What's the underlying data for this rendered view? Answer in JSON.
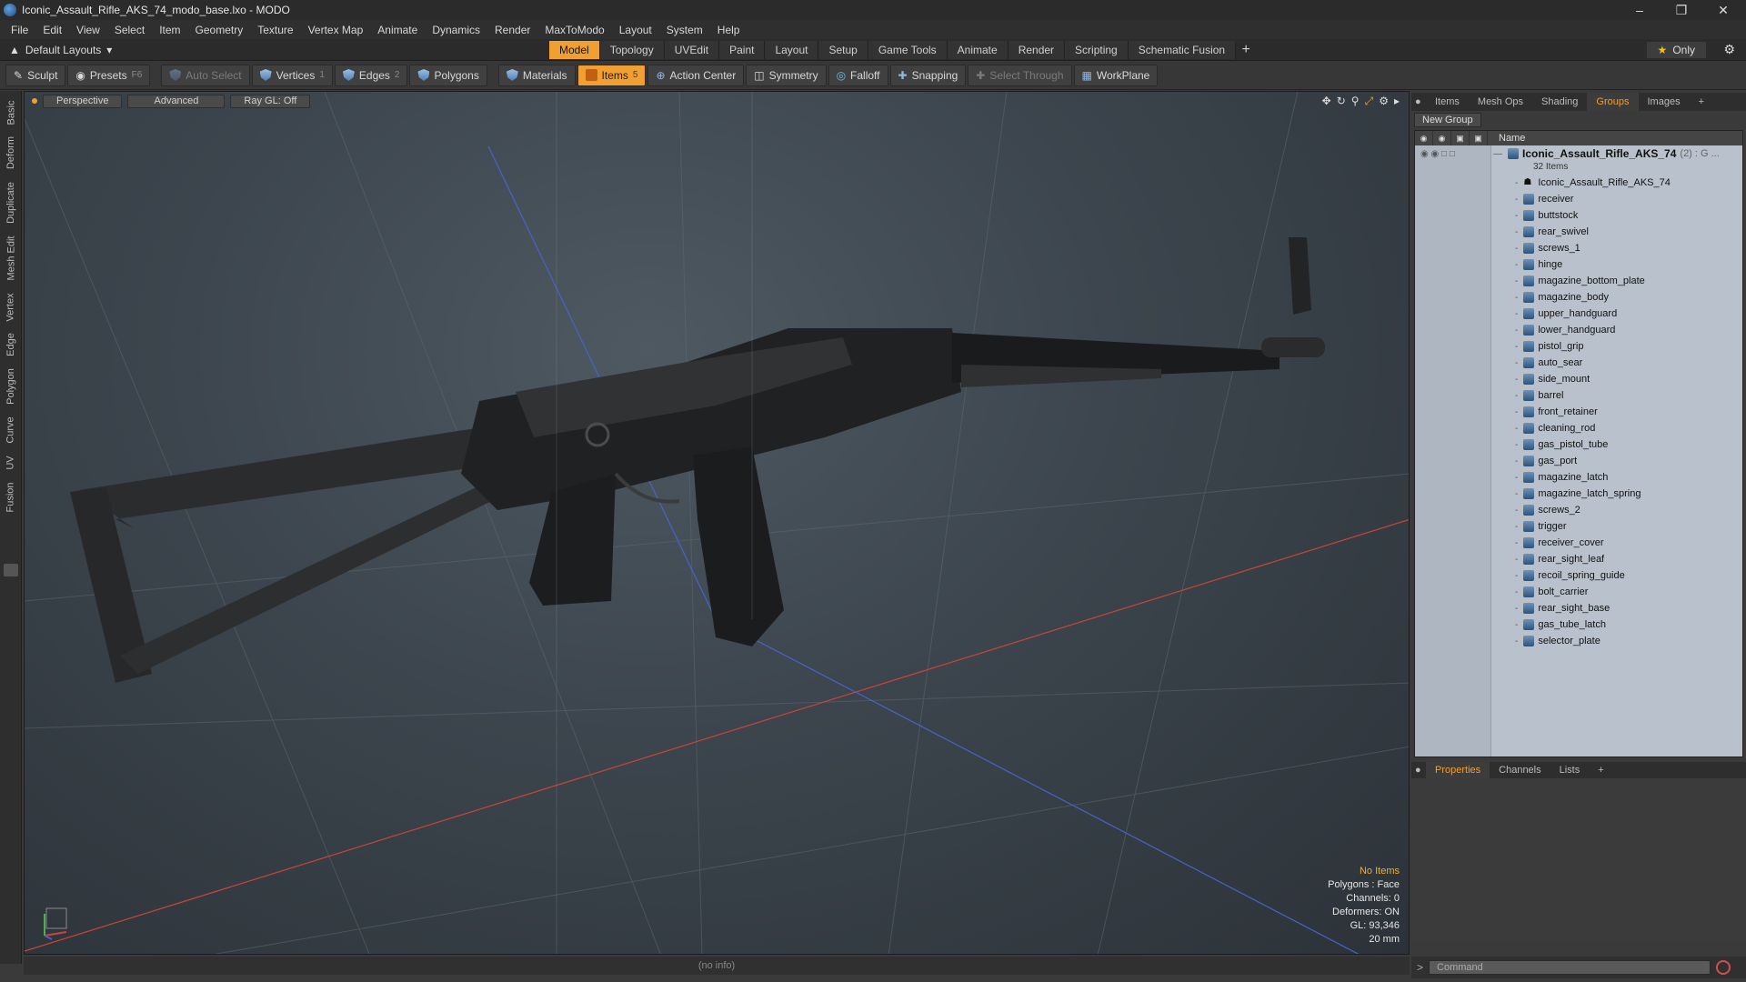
{
  "window": {
    "title": "Iconic_Assault_Rifle_AKS_74_modo_base.lxo - MODO"
  },
  "menu": [
    "File",
    "Edit",
    "View",
    "Select",
    "Item",
    "Geometry",
    "Texture",
    "Vertex Map",
    "Animate",
    "Dynamics",
    "Render",
    "MaxToModo",
    "Layout",
    "System",
    "Help"
  ],
  "layoutbar": {
    "layout_select": "Default Layouts",
    "tabs": [
      "Model",
      "Topology",
      "UVEdit",
      "Paint",
      "Layout",
      "Setup",
      "Game Tools",
      "Animate",
      "Render",
      "Scripting",
      "Schematic Fusion"
    ],
    "active_tab": "Model",
    "only_label": "Only"
  },
  "toolbar": {
    "sculpt": "Sculpt",
    "presets": "Presets",
    "presets_key": "F6",
    "auto_select": "Auto Select",
    "vertices": "Vertices",
    "vertices_key": "1",
    "edges": "Edges",
    "edges_key": "2",
    "polygons": "Polygons",
    "materials": "Materials",
    "items": "Items",
    "items_key": "5",
    "action_center": "Action Center",
    "symmetry": "Symmetry",
    "falloff": "Falloff",
    "snapping": "Snapping",
    "select_through": "Select Through",
    "workplane": "WorkPlane"
  },
  "left_tabs": [
    "Basic",
    "Deform",
    "Duplicate",
    "Mesh Edit",
    "Vertex",
    "Edge",
    "Polygon",
    "Curve",
    "UV",
    "Fusion"
  ],
  "viewport": {
    "view_mode": "Perspective",
    "shading": "Advanced",
    "raygl": "Ray GL: Off",
    "info": {
      "selection": "No Items",
      "polygons": "Polygons : Face",
      "channels": "Channels: 0",
      "deformers": "Deformers: ON",
      "gl": "GL: 93,346",
      "scale": "20 mm"
    },
    "colors": {
      "x_axis": "#c8453a",
      "z_axis": "#4a62c8",
      "accent": "#f0a030"
    }
  },
  "right_panel": {
    "tabs": [
      "Items",
      "Mesh Ops",
      "Shading",
      "Groups",
      "Images"
    ],
    "active_tab": "Groups",
    "new_group": "New Group",
    "tree_header": "Name",
    "root": {
      "name": "Iconic_Assault_Rifle_AKS_74",
      "count": "(2) : G ...",
      "items_count": "32 Items"
    },
    "items": [
      "Iconic_Assault_Rifle_AKS_74",
      "receiver",
      "buttstock",
      "rear_swivel",
      "screws_1",
      "hinge",
      "magazine_bottom_plate",
      "magazine_body",
      "upper_handguard",
      "lower_handguard",
      "pistol_grip",
      "auto_sear",
      "side_mount",
      "barrel",
      "front_retainer",
      "cleaning_rod",
      "gas_pistol_tube",
      "gas_port",
      "magazine_latch",
      "magazine_latch_spring",
      "screws_2",
      "trigger",
      "receiver_cover",
      "rear_sight_leaf",
      "recoil_spring_guide",
      "bolt_carrier",
      "rear_sight_base",
      "gas_tube_latch",
      "selector_plate"
    ],
    "bottom_tabs": [
      "Properties",
      "Channels",
      "Lists"
    ],
    "bottom_active": "Properties"
  },
  "status": {
    "info": "(no info)"
  },
  "command": {
    "placeholder": "Command"
  }
}
